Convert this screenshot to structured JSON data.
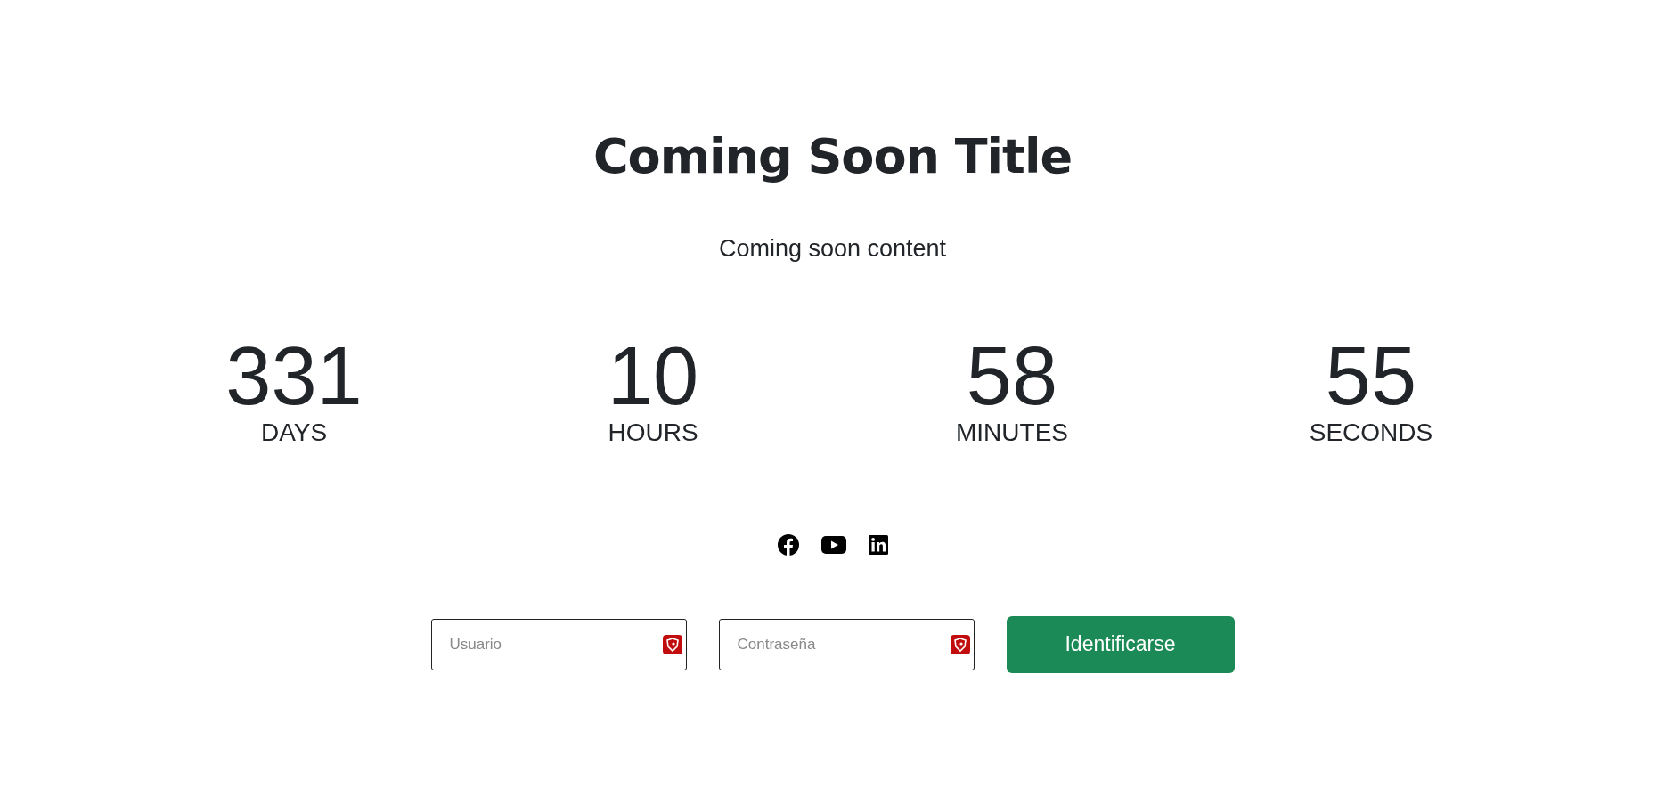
{
  "title": "Coming Soon Title",
  "content": "Coming soon content",
  "countdown": [
    {
      "value": "331",
      "unit": "DAYS"
    },
    {
      "value": "10",
      "unit": "HOURS"
    },
    {
      "value": "58",
      "unit": "MINUTES"
    },
    {
      "value": "55",
      "unit": "SECONDS"
    }
  ],
  "social": [
    {
      "kind": "facebook"
    },
    {
      "kind": "youtube"
    },
    {
      "kind": "linkedin"
    }
  ],
  "login": {
    "fields": [
      {
        "placeholder": "Usuario"
      },
      {
        "placeholder": "Contraseña"
      }
    ],
    "button": "Identificarse"
  }
}
